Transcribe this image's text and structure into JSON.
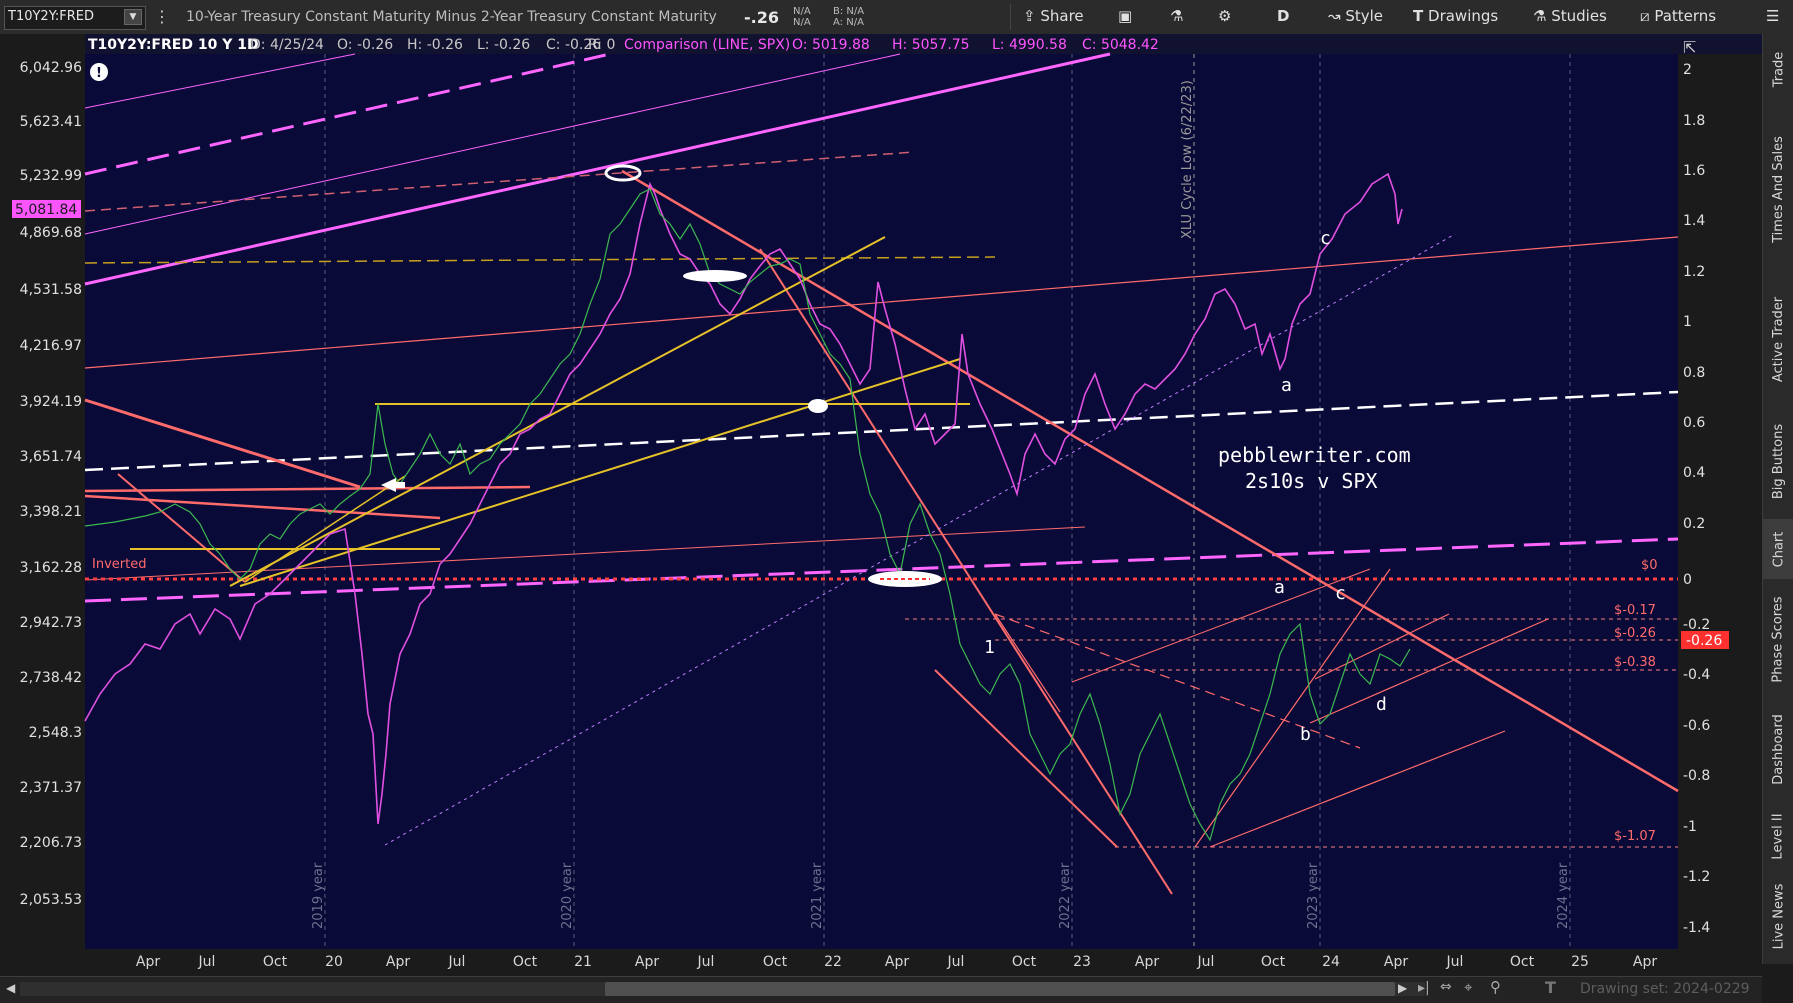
{
  "toolbar": {
    "symbol": "T10Y2Y:FRED",
    "title": "10-Year Treasury Constant Maturity Minus 2-Year Treasury Constant Maturity",
    "last": "-.26",
    "bid_label": "N/A",
    "ask_label": "N/A",
    "b_label": "B: N/A",
    "a_label": "A: N/A",
    "share": "Share",
    "aggregation": "D",
    "style": "Style",
    "drawings": "Drawings",
    "studies": "Studies",
    "patterns": "Patterns"
  },
  "infobar": {
    "symbol": "T10Y2Y:FRED 10 Y 1D",
    "date": "D: 4/25/24",
    "open": "O: -0.26",
    "high": "H: -0.26",
    "low": "L: -0.26",
    "close": "C: -0.26",
    "range": "R: 0",
    "comparison": "Comparison (LINE, SPX)",
    "c_open": "O: 5019.88",
    "c_high": "H: 5057.75",
    "c_low": "L: 4990.58",
    "c_close": "C: 5048.42"
  },
  "left_axis": [
    "6,042.96",
    "5,623.41",
    "5,232.99",
    "4,869.68",
    "4,531.58",
    "4,216.97",
    "3,924.19",
    "3,651.74",
    "3,398.21",
    "3,162.28",
    "2,942.73",
    "2,738.42",
    "2,548.3",
    "2,371.37",
    "2,206.73",
    "2,053.53"
  ],
  "left_marker": "5,081.84",
  "right_axis": [
    "2",
    "1.8",
    "1.6",
    "1.4",
    "1.2",
    "1",
    "0.8",
    "0.6",
    "0.4",
    "0.2",
    "0",
    "-0.2",
    "-0.4",
    "-0.6",
    "-0.8",
    "-1",
    "-1.2",
    "-1.4"
  ],
  "right_marker": "-0.26",
  "x_axis": [
    "Apr",
    "Jul",
    "Oct",
    "20",
    "Apr",
    "Jul",
    "Oct",
    "21",
    "Apr",
    "Jul",
    "Oct",
    "22",
    "Apr",
    "Jul",
    "Oct",
    "23",
    "Apr",
    "Jul",
    "Oct",
    "24",
    "Apr",
    "Jul",
    "Oct",
    "25",
    "Apr"
  ],
  "year_labels": [
    "2019 year",
    "2020 year",
    "2021 year",
    "2022 year",
    "2023 year",
    "2024 year"
  ],
  "cycle_label": "XLU Cycle Low (6/22/23)",
  "watermark": [
    "pebblewriter.com",
    "2s10s v SPX"
  ],
  "level_labels": [
    "$0",
    "$-0.17",
    "$-0.26",
    "$-0.38",
    "$-1.07"
  ],
  "inverted_label": "Inverted",
  "wave_labels": {
    "a_top": "a",
    "c_top": "c",
    "a_mid": "a",
    "c_mid": "c",
    "b_mid": "b",
    "d_mid": "d",
    "one": "1"
  },
  "right_tabs": [
    "Trade",
    "Times And Sales",
    "Active Trader",
    "Big Buttons",
    "Chart",
    "Phase Scores",
    "Dashboard",
    "Level II",
    "Live News"
  ],
  "active_tab": "Chart",
  "drawing_set": "Drawing set: 2024-0229",
  "colors": {
    "background": "#0a0a38",
    "spx": "#e050e0",
    "spread_up": "#3cb850",
    "spread_down": "#c06040",
    "trend": "#ff6b6b",
    "yellow": "#e6c229",
    "magenta": "#ff66ff"
  }
}
